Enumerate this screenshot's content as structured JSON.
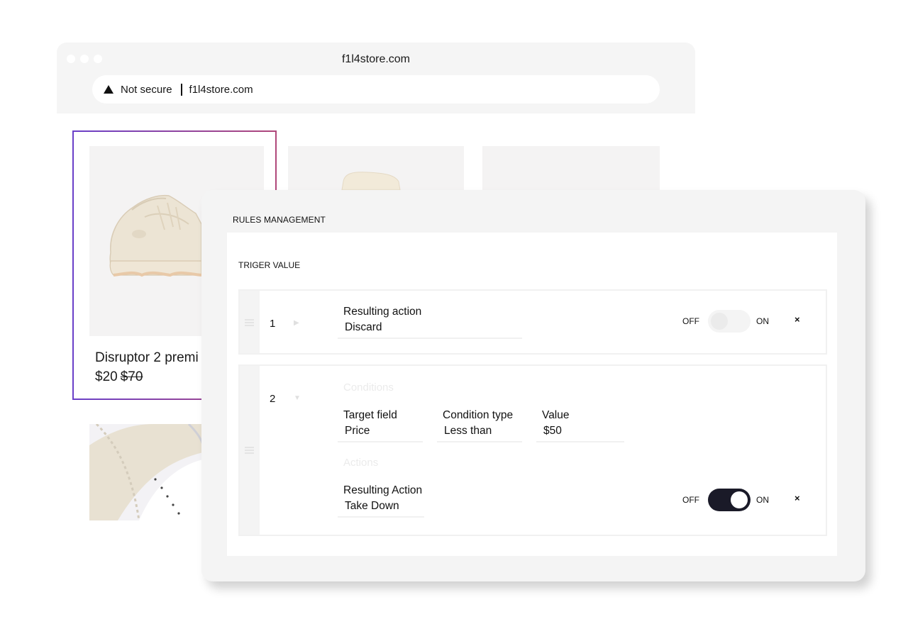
{
  "browser": {
    "title": "f1l4store.com",
    "security": "Not secure",
    "url": "f1l4store.com"
  },
  "store": {
    "product_name": "Disruptor 2 premi",
    "price": "$20",
    "old_price": "$70"
  },
  "rules_panel": {
    "title": "RULES MANAGEMENT",
    "section_title": "TRIGER VALUE",
    "rules": [
      {
        "number": "1",
        "action_label": "Resulting action",
        "action_value": "Discard",
        "toggle_off_label": "OFF",
        "toggle_on_label": "ON",
        "enabled": false,
        "close": "×"
      },
      {
        "number": "2",
        "conditions_heading": "Conditions",
        "target_field_label": "Target field",
        "target_field_value": "Price",
        "condition_type_label": "Condition type",
        "condition_type_value": "Less than",
        "value_label": "Value",
        "value_value": "$50",
        "actions_heading": "Actions",
        "action_label": "Resulting Action",
        "action_value": "Take Down",
        "toggle_off_label": "OFF",
        "toggle_on_label": "ON",
        "enabled": true,
        "close": "×"
      }
    ]
  },
  "colors": {
    "toggle_on": "#1a1a28",
    "selection_gradient_start": "#6a3fc8",
    "selection_gradient_end": "#b0477a"
  }
}
